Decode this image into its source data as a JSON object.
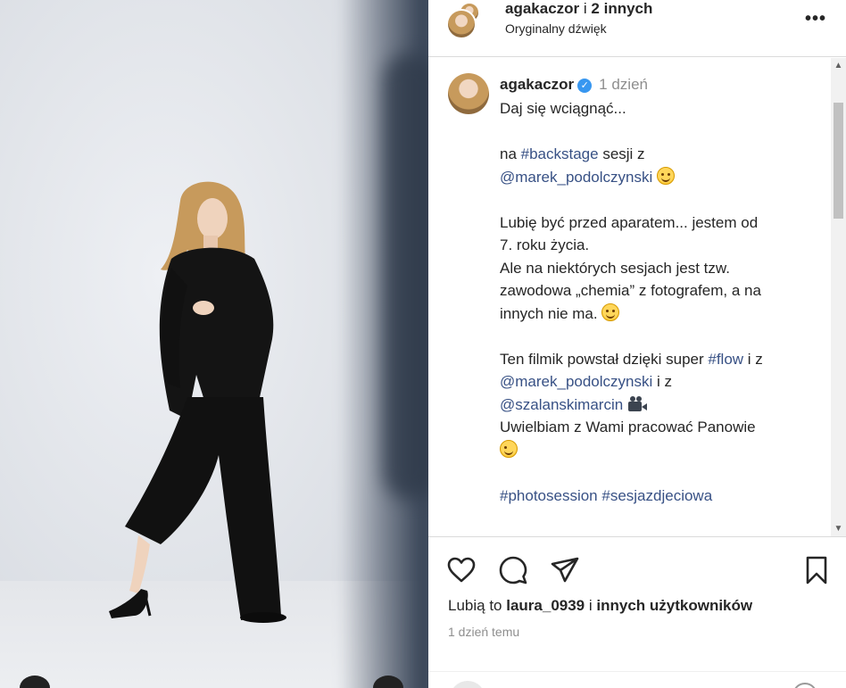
{
  "header": {
    "username": "agakaczor",
    "separator": "i",
    "others": "2 innych",
    "audio": "Oryginalny dźwięk",
    "more_label": "•••"
  },
  "post": {
    "username": "agakaczor",
    "verified_mark": "✓",
    "time": "1 dzień",
    "caption": {
      "l1": "Daj się wciągnąć...",
      "l3a": "na ",
      "l3tag": "#backstage",
      "l3b": " sesji z",
      "l4tag": "@marek_podolczynski",
      "l6": "Lubię być przed aparatem... jestem od",
      "l7": "7. roku życia.",
      "l8": "Ale na niektórych sesjach jest tzw.",
      "l9": "zawodowa „chemia” z fotografem, a na",
      "l10": "innych nie ma.",
      "l12a": "Ten filmik powstał dzięki super ",
      "l12tag": "#flow",
      "l12b": " i z",
      "l13tag": "@marek_podolczynski",
      "l13b": " i z",
      "l14tag": "@szalanskimarcin",
      "l15": "Uwielbiam z Wami pracować Panowie",
      "l17tag1": "#photosession",
      "l17tag2": "#sesjazdjeciowa"
    }
  },
  "actions": {
    "icons": [
      "heart-icon",
      "comment-icon",
      "share-icon",
      "bookmark-icon"
    ],
    "likes_prefix": "Lubią to ",
    "likes_user": "laura_0939",
    "likes_mid": " i ",
    "likes_rest": "innych użytkowników",
    "date": "1 dzień temu"
  },
  "colors": {
    "link": "#385185",
    "verified": "#3897f0",
    "muted": "#8e8e8e",
    "divider": "#dbdbdb"
  }
}
